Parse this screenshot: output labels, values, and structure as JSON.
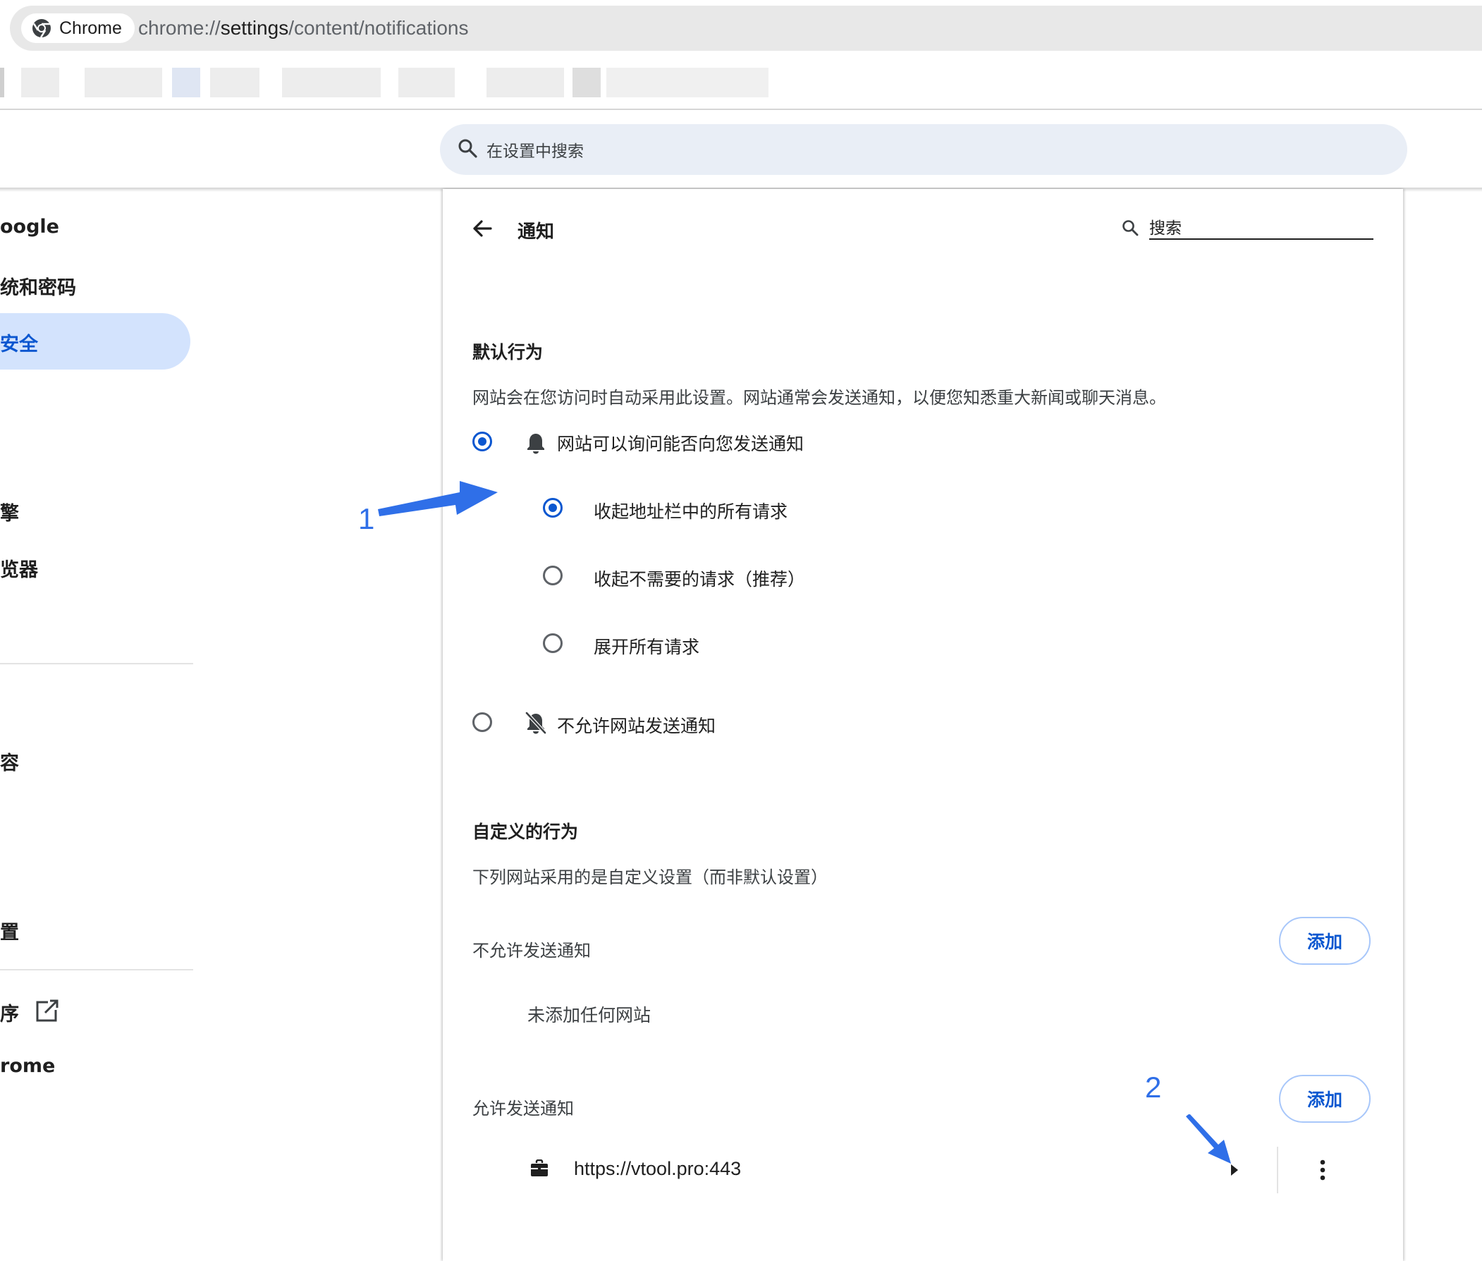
{
  "browser": {
    "chip_label": "Chrome",
    "url_scheme": "chrome://",
    "url_host": "settings",
    "url_path": "/content/notifications"
  },
  "header": {
    "search_placeholder": "在设置中搜索"
  },
  "sidebar": {
    "items": [
      {
        "label": "oogle"
      },
      {
        "label": "统和密码"
      },
      {
        "label": "安全",
        "active": true
      },
      {
        "label": "擎"
      },
      {
        "label": "览器"
      },
      {
        "label": "容"
      },
      {
        "label": "置"
      },
      {
        "label": "序"
      },
      {
        "label": "rome"
      }
    ]
  },
  "page": {
    "title": "通知",
    "search_placeholder": "搜索",
    "default_behavior": {
      "title": "默认行为",
      "description": "网站会在您访问时自动采用此设置。网站通常会发送通知，以便您知悉重大新闻或聊天消息。",
      "allow_option": "网站可以询问能否向您发送通知",
      "sub_options": [
        {
          "label": "收起地址栏中的所有请求",
          "selected": true
        },
        {
          "label": "收起不需要的请求（推荐）",
          "selected": false
        },
        {
          "label": "展开所有请求",
          "selected": false
        }
      ],
      "block_option": "不允许网站发送通知"
    },
    "custom_behavior": {
      "title": "自定义的行为",
      "description": "下列网站采用的是自定义设置（而非默认设置）",
      "blocked": {
        "label": "不允许发送通知",
        "add_label": "添加",
        "empty_text": "未添加任何网站"
      },
      "allowed": {
        "label": "允许发送通知",
        "add_label": "添加",
        "sites": [
          {
            "url": "https://vtool.pro:443"
          }
        ]
      }
    }
  },
  "annotations": {
    "marker_1": "1",
    "marker_2": "2",
    "color": "#2f6fe8"
  },
  "colors": {
    "accent": "#0b57d0",
    "active_nav_bg": "#d3e3fd",
    "search_bg": "#e9eef6"
  }
}
